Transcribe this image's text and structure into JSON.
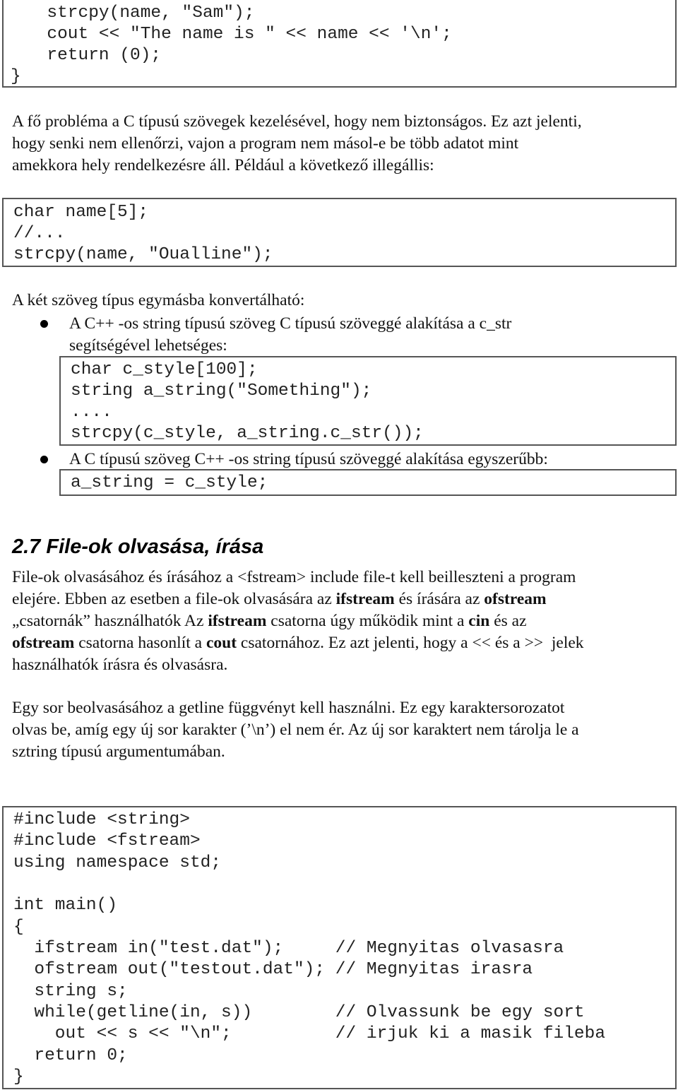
{
  "code_block_1": {
    "lines": [
      "  strcpy(name, \"Sam\");",
      "  cout << \"The name is \" << name << '\\n';",
      "  return (0);",
      "}"
    ]
  },
  "paragraph_1": {
    "lines": [
      "A fő probléma a C típusú szövegek kezelésével, hogy nem biztonságos. Ez azt jelenti,",
      "hogy senki nem ellenőrzi, vajon a program nem másol-e be több adatot mint",
      "amekkora hely rendelkezésre áll. Például a következő illegállis:"
    ]
  },
  "code_block_2": {
    "lines": [
      "char name[5];",
      "//...",
      "strcpy(name, \"Oualline\");"
    ]
  },
  "paragraph_2": {
    "intro": "A két szöveg típus egymásba konvertálható:",
    "bullets": [
      {
        "lines": [
          "A C++ -os string típusú szöveg C típusú szöveggé alakítása a c_str",
          "segítségével lehetséges:"
        ],
        "code": [
          "char c_style[100];",
          "string a_string(\"Something\");",
          "....",
          "strcpy(c_style, a_string.c_str());"
        ]
      },
      {
        "lines": [
          "A C típusú szöveg C++ -os string típusú szöveggé alakítása egyszerűbb:"
        ],
        "code": [
          "a_string = c_style;"
        ]
      }
    ]
  },
  "section": {
    "heading": "2.7 File-ok olvasása, írása",
    "para1": {
      "l1": "File-ok olvasásához és írásához a <fstream> include file-t kell beilleszteni a program",
      "l2_a": "elejére. Ebben az esetben a file-ok olvasására az ",
      "l2_b": "ifstream",
      "l2_c": " és írására az ",
      "l2_d": "ofstream",
      "l3_a": "„csatornák” használhatók Az ",
      "l3_b": "ifstream",
      "l3_c": " csatorna úgy működik mint a ",
      "l3_d": "cin",
      "l3_e": " és az",
      "l4_a": "ofstream",
      "l4_b": " csatorna hasonlít a ",
      "l4_c": "cout",
      "l4_d": " csatornához. Ez azt jelenti, hogy a << és a >>  jelek",
      "l5": "használhatók írásra és olvasásra."
    },
    "para2": {
      "lines": [
        "Egy sor beolvasásához a getline függvényt kell használni. Ez egy karaktersorozatot",
        "olvas be, amíg egy új sor karakter (’\\n’) el nem ér. Az új sor karaktert nem tárolja le a",
        "sztring típusú argumentumában."
      ]
    }
  },
  "code_block_3": {
    "lines": [
      "#include <string>",
      "#include <fstream>",
      "using namespace std;",
      "",
      "int main()",
      "{",
      "  ifstream in(\"test.dat\");     // Megnyitas olvasasra",
      "  ofstream out(\"testout.dat\"); // Megnyitas irasra",
      "  string s;",
      "  while(getline(in, s))        // Olvassunk be egy sort",
      "    out << s << \"\\n\";          // irjuk ki a masik fileba",
      "  return 0;",
      "}"
    ]
  }
}
